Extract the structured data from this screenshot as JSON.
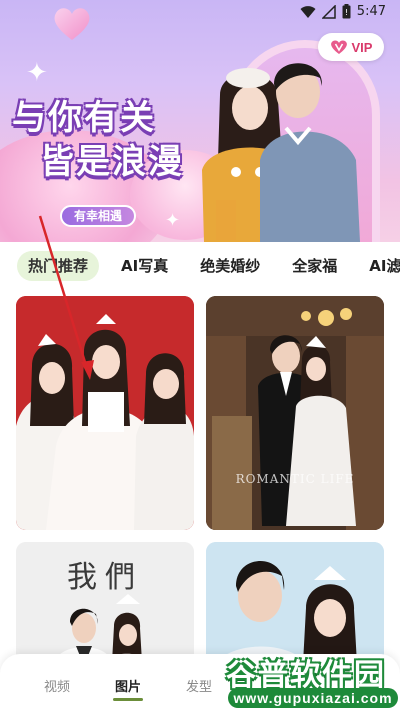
{
  "status_bar": {
    "time": "5:47",
    "icons": [
      "wifi-icon",
      "signal-icon",
      "battery-icon"
    ]
  },
  "banner": {
    "headline_line1": "与你有关",
    "headline_line2": "皆是浪漫",
    "tagline": "有幸相遇",
    "vip_label": "VIP",
    "colors": {
      "headline_outline": "#7a3fb4",
      "vip_text": "#d93a6b"
    }
  },
  "categories": {
    "items": [
      "热门推荐",
      "AI写真",
      "绝美婚纱",
      "全家福",
      "AI滤"
    ],
    "active_index": 0,
    "active_bg": "#e7f4da"
  },
  "gallery": {
    "cards": [
      {
        "theme": "red-background bridal trio"
      },
      {
        "theme": "vintage cabin wedding couple",
        "caption": "ROMANTIC LIFE"
      },
      {
        "theme": "couple portrait",
        "title": "我們"
      },
      {
        "theme": "blue-background couple portrait"
      }
    ]
  },
  "bottom_nav": {
    "items": [
      "视频",
      "图片",
      "发型"
    ],
    "active_index": 1,
    "accent": "#6b8e3a"
  },
  "watermark": {
    "main": "谷普软件园",
    "url": "www.gupuxiazai.com"
  }
}
